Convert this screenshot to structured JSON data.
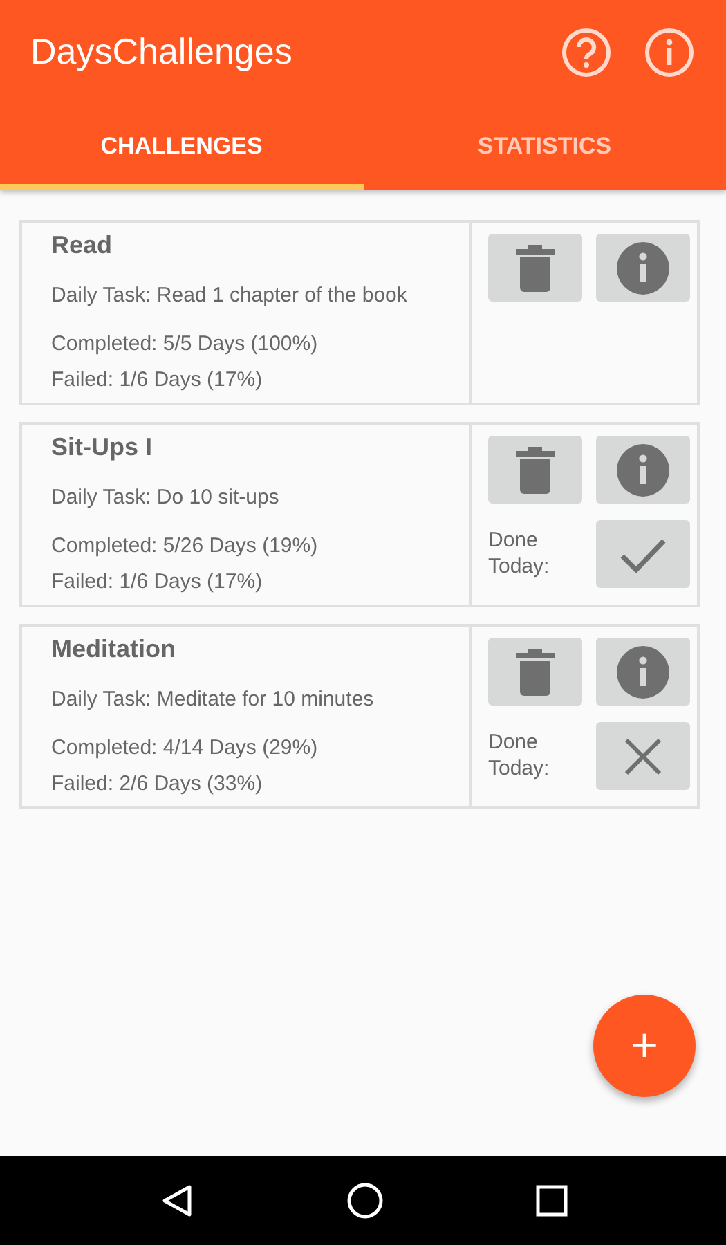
{
  "app_bar": {
    "title": "DaysChallenges"
  },
  "tabs": [
    {
      "label": "CHALLENGES",
      "selected": true
    },
    {
      "label": "STATISTICS",
      "selected": false
    }
  ],
  "challenges": [
    {
      "name": "Read",
      "task": "Daily Task: Read 1 chapter of the book",
      "completed": "Completed: 5/5 Days (100%)",
      "failed": "Failed: 1/6 Days (17%)"
    },
    {
      "name": "Sit-Ups I",
      "task": "Daily Task: Do 10 sit-ups",
      "completed": "Completed: 5/26 Days (19%)",
      "failed": "Failed: 1/6 Days (17%)",
      "done_label": "Done Today:",
      "done_today": true
    },
    {
      "name": "Meditation",
      "task": "Daily Task: Meditate for 10 minutes",
      "completed": "Completed: 4/14 Days (29%)",
      "failed": "Failed: 2/6 Days (33%)",
      "done_label": "Done Today:",
      "done_today": false
    }
  ],
  "fab": {
    "label": "+"
  }
}
